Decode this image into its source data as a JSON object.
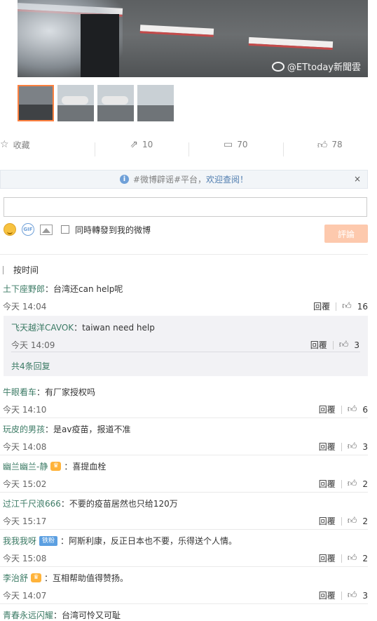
{
  "media": {
    "watermark": "@ETtoday新聞雲"
  },
  "actions": {
    "favorite": "收藏",
    "forward": "10",
    "comment": "70",
    "like": "78"
  },
  "notice": {
    "prefix": "#微博辟谣#平台，",
    "link": "欢迎查阅！",
    "close": "×"
  },
  "composer": {
    "forward_label": "同時轉發到我的微博",
    "submit": "評論"
  },
  "sort": {
    "label": "按时间"
  },
  "comments": [
    {
      "user": "土下座野郎",
      "text": "：台湾还can help呢",
      "time": "今天 14:04",
      "reply_label": "回覆",
      "likes": "16"
    },
    {
      "user": "牛眼看车",
      "text": "：有厂家授权吗",
      "time": "今天 14:10",
      "reply_label": "回覆",
      "likes": "6"
    },
    {
      "user": "玩皮的男孩",
      "text": "：是av疫苗，报道不准",
      "time": "今天 14:08",
      "reply_label": "回覆",
      "likes": "3"
    },
    {
      "user": "幽兰幽兰-静",
      "text": "：喜提血栓",
      "time": "今天 15:02",
      "reply_label": "回覆",
      "likes": "2"
    },
    {
      "user": "过江千尺浪666",
      "text": "：不要的疫苗居然也只给120万",
      "time": "今天 15:17",
      "reply_label": "回覆",
      "likes": "2"
    },
    {
      "user": "我我我呀",
      "badge": "铁粉",
      "text": "：阿斯利康，反正日本也不要，乐得送个人情。",
      "time": "今天 15:08",
      "reply_label": "回覆",
      "likes": "2"
    },
    {
      "user": "李治舒",
      "text": "：互相帮助值得赞扬。",
      "time": "今天 14:07",
      "reply_label": "回覆",
      "likes": "3"
    },
    {
      "user": "青春永远闪耀",
      "text": "：台湾可怜又可耻"
    }
  ],
  "reply": {
    "user": "飞天越洋CAVOK",
    "text": "：taiwan need help",
    "time": "今天 14:09",
    "reply_label": "回覆",
    "likes": "3",
    "more": "共4条回复"
  }
}
